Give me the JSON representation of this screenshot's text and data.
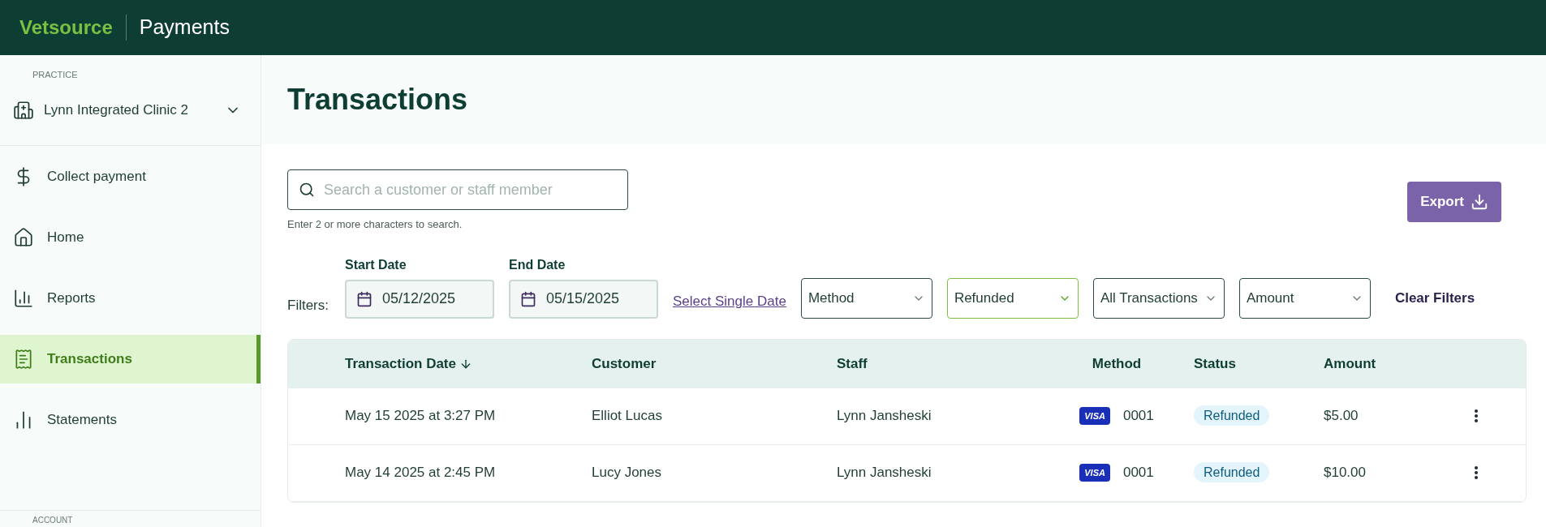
{
  "header": {
    "brand": "Vetsource",
    "product": "Payments"
  },
  "sidebar": {
    "section": "PRACTICE",
    "practice": "Lynn Integrated Clinic 2",
    "items": [
      {
        "label": "Collect payment",
        "selected": false
      },
      {
        "label": "Home",
        "selected": false
      },
      {
        "label": "Reports",
        "selected": false
      },
      {
        "label": "Transactions",
        "selected": true
      },
      {
        "label": "Statements",
        "selected": false
      }
    ],
    "section_2": "ACCOUNT"
  },
  "page": {
    "title": "Transactions"
  },
  "search": {
    "placeholder": "Search a customer or staff member",
    "hint": "Enter 2 or more characters to search."
  },
  "export_button": "Export",
  "filters": {
    "label": "Filters:",
    "start_date": {
      "label": "Start Date",
      "value": "05/12/2025"
    },
    "end_date": {
      "label": "End Date",
      "value": "05/15/2025"
    },
    "single_date_link": "Select Single Date",
    "selects": [
      {
        "value": "Method",
        "active": false
      },
      {
        "value": "Refunded",
        "active": true
      },
      {
        "value": "All Transactions",
        "active": false
      },
      {
        "value": "Amount",
        "active": false
      }
    ],
    "clear": "Clear Filters"
  },
  "table": {
    "columns": [
      "Transaction Date",
      "Customer",
      "Staff",
      "Method",
      "Status",
      "Amount"
    ],
    "rows": [
      {
        "date": "May 15 2025 at 3:27 PM",
        "customer": "Elliot Lucas",
        "staff": "Lynn Jansheski",
        "card": "VISA",
        "last4": "0001",
        "status": "Refunded",
        "amount": "$5.00"
      },
      {
        "date": "May 14 2025 at 2:45 PM",
        "customer": "Lucy Jones",
        "staff": "Lynn Jansheski",
        "card": "VISA",
        "last4": "0001",
        "status": "Refunded",
        "amount": "$10.00"
      }
    ]
  }
}
